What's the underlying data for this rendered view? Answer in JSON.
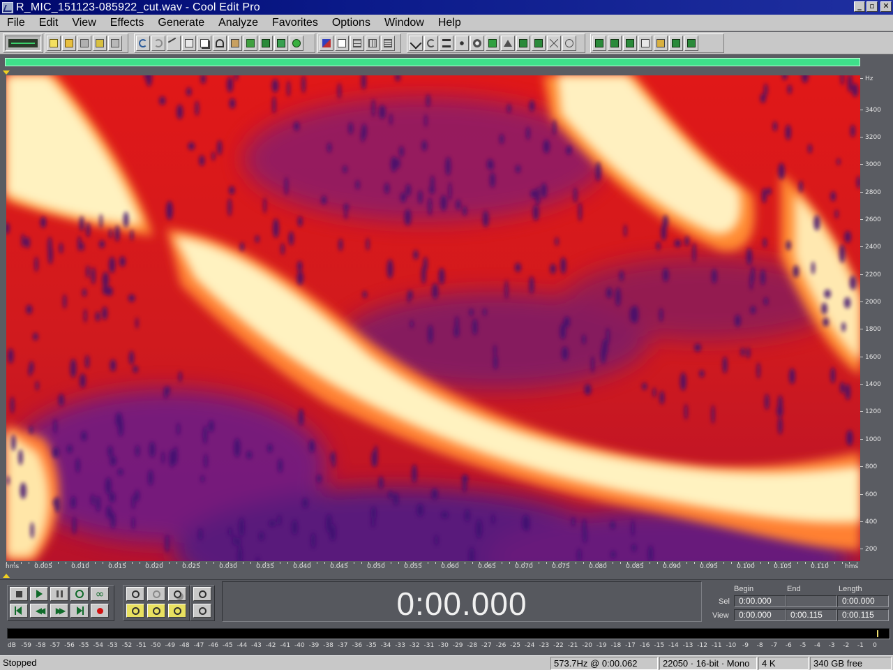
{
  "window": {
    "title": "R_MIC_151123-085922_cut.wav - Cool Edit Pro",
    "buttons": {
      "minimize": "_",
      "restore": "▫",
      "close": "✕"
    }
  },
  "menu": [
    "File",
    "Edit",
    "View",
    "Effects",
    "Generate",
    "Analyze",
    "Favorites",
    "Options",
    "Window",
    "Help"
  ],
  "spectral": {
    "freq_unit": "Hz",
    "freq_ticks": [
      "3400",
      "3200",
      "3000",
      "2800",
      "2600",
      "2400",
      "2200",
      "2000",
      "1800",
      "1600",
      "1400",
      "1200",
      "1000",
      "800",
      "600",
      "400",
      "200"
    ],
    "time_unit_left": "hms",
    "time_unit_right": "hms",
    "time_ticks": [
      "0.005",
      "0.010",
      "0.015",
      "0.020",
      "0.025",
      "0.030",
      "0.035",
      "0.040",
      "0.045",
      "0.050",
      "0.055",
      "0.060",
      "0.065",
      "0.070",
      "0.075",
      "0.080",
      "0.085",
      "0.090",
      "0.095",
      "0.100",
      "0.105",
      "0.110"
    ],
    "colors": {
      "hot": "#fff6c8",
      "mid": "#ff1a10",
      "low": "#3a1470"
    }
  },
  "transport": {
    "time": "0:00.000"
  },
  "selection": {
    "headers": {
      "begin": "Begin",
      "end": "End",
      "length": "Length"
    },
    "sel_label": "Sel",
    "view_label": "View",
    "sel": {
      "begin": "0:00.000",
      "end": "",
      "length": "0:00.000"
    },
    "view": {
      "begin": "0:00.000",
      "end": "0:00.115",
      "length": "0:00.115"
    }
  },
  "level_meter": {
    "db_ticks": [
      "dB",
      "-59",
      "-58",
      "-57",
      "-56",
      "-55",
      "-54",
      "-53",
      "-52",
      "-51",
      "-50",
      "-49",
      "-48",
      "-47",
      "-46",
      "-45",
      "-44",
      "-43",
      "-42",
      "-41",
      "-40",
      "-39",
      "-38",
      "-37",
      "-36",
      "-35",
      "-34",
      "-33",
      "-32",
      "-31",
      "-30",
      "-29",
      "-28",
      "-27",
      "-26",
      "-25",
      "-24",
      "-23",
      "-22",
      "-21",
      "-20",
      "-19",
      "-18",
      "-17",
      "-16",
      "-15",
      "-14",
      "-13",
      "-12",
      "-11",
      "-10",
      "-9",
      "-8",
      "-7",
      "-6",
      "-5",
      "-4",
      "-3",
      "-2",
      "-1",
      "0"
    ]
  },
  "status": {
    "state": "Stopped",
    "cursor": "573.7Hz @   0:00.062",
    "format": "22050 · 16-bit · Mono",
    "size": "4 K",
    "free": "340 GB free"
  }
}
